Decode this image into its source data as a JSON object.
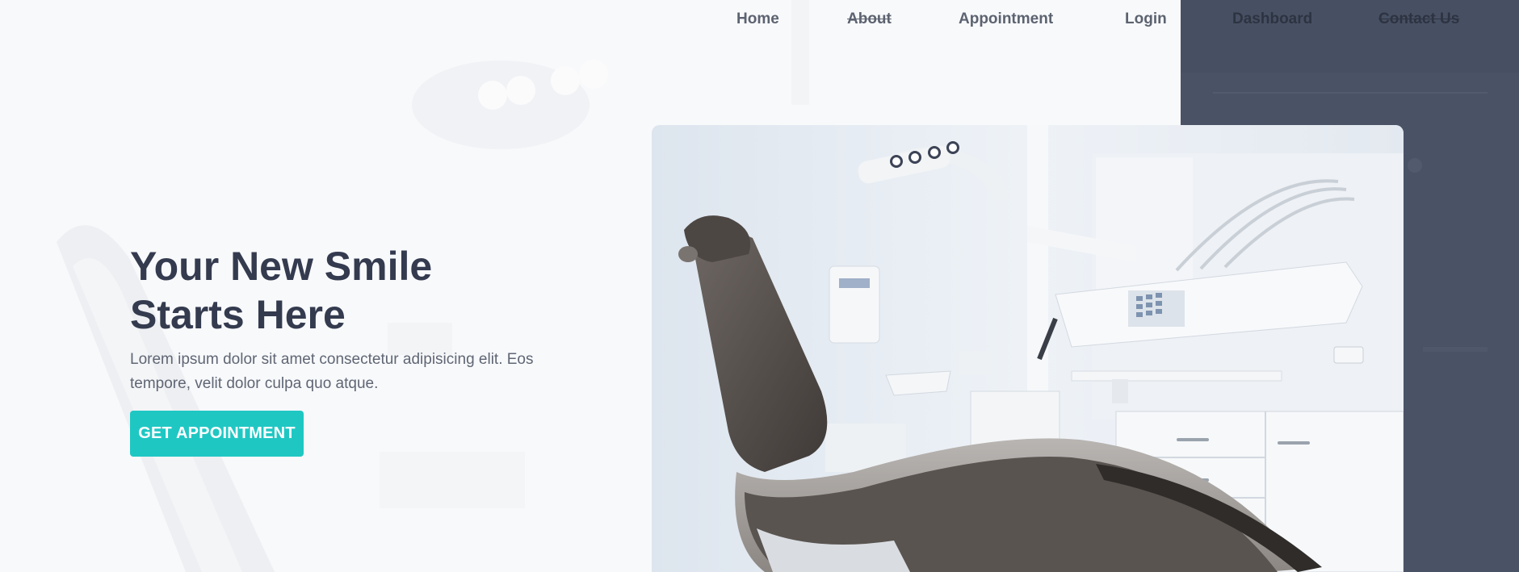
{
  "nav": {
    "items": [
      {
        "label": "Home"
      },
      {
        "label": "About"
      },
      {
        "label": "Appointment"
      },
      {
        "label": "Login"
      },
      {
        "label": "Dashboard"
      },
      {
        "label": "Contact Us"
      }
    ]
  },
  "hero": {
    "title_line1": "Your New Smile",
    "title_line2": "Starts Here",
    "description": "Lorem ipsum dolor sit amet consectetur adipisicing elit. Eos tempore, velit dolor culpa quo atque.",
    "cta_label": "GET APPOINTMENT"
  },
  "colors": {
    "accent": "#1fc7c3",
    "heading": "#343b4f",
    "panel": "#475063",
    "nav_text": "#5c6370"
  },
  "images": {
    "hero_photo": "dental-chair-photo",
    "background": "faded-dental-chair-background"
  }
}
